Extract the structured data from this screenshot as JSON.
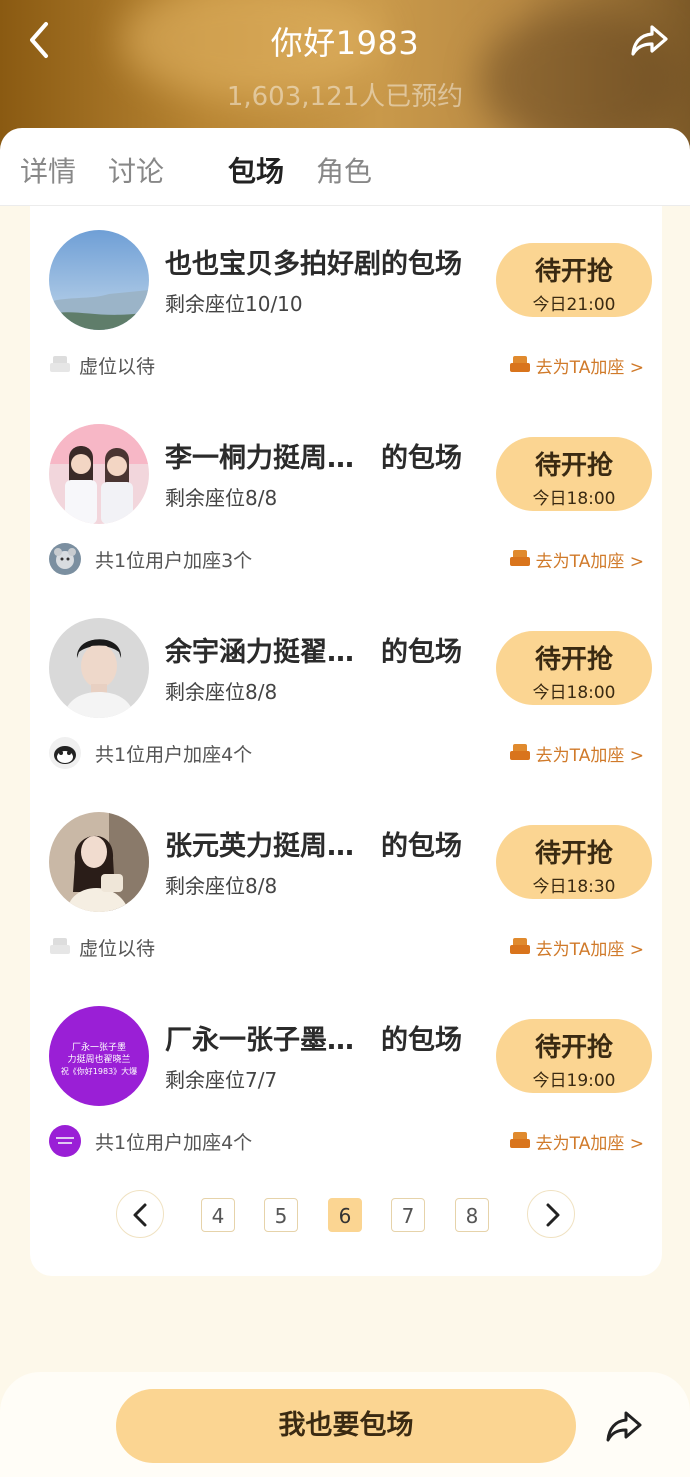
{
  "header": {
    "title": "你好1983",
    "subtitle": "1,603,121人已预约"
  },
  "tabs": [
    {
      "label": "详情"
    },
    {
      "label": "讨论"
    },
    {
      "label": "包场"
    },
    {
      "label": "角色"
    }
  ],
  "active_tab": "包场",
  "items": [
    {
      "title": "也也宝贝多拍好剧的包场",
      "seats": "剩余座位10/10",
      "btn_main": "待开抢",
      "btn_time": "今日21:00",
      "footer_left": "虚位以待",
      "footer_right": "去为TA加座 >",
      "avatar_icon": "landscape-avatar-icon"
    },
    {
      "title": "李一桐力挺周…　的包场",
      "seats": "剩余座位8/8",
      "btn_main": "待开抢",
      "btn_time": "今日18:00",
      "footer_left": "共1位用户加座3个",
      "footer_right": "去为TA加座 >",
      "avatar_icon": "two-girls-avatar-icon"
    },
    {
      "title": "余宇涵力挺翟…　的包场",
      "seats": "剩余座位8/8",
      "btn_main": "待开抢",
      "btn_time": "今日18:00",
      "footer_left": "共1位用户加座4个",
      "footer_right": "去为TA加座 >",
      "avatar_icon": "man-portrait-avatar-icon"
    },
    {
      "title": "张元英力挺周…　的包场",
      "seats": "剩余座位8/8",
      "btn_main": "待开抢",
      "btn_time": "今日18:30",
      "footer_left": "虚位以待",
      "footer_right": "去为TA加座 >",
      "avatar_icon": "girl-portrait-avatar-icon"
    },
    {
      "title": "厂永一张子墨…　的包场",
      "seats": "剩余座位7/7",
      "btn_main": "待开抢",
      "btn_time": "今日19:00",
      "footer_left": "共1位用户加座4个",
      "footer_right": "去为TA加座 >",
      "avatar_icon": "purple-text-avatar-icon",
      "avatar_text": [
        "厂永一张子墨",
        "力挺周也翟晓兰",
        "祝《你好1983》大爆"
      ]
    }
  ],
  "pagination": {
    "pages": [
      "4",
      "5",
      "6",
      "7",
      "8"
    ],
    "current": "6"
  },
  "bottom": {
    "cta_label": "我也要包场"
  },
  "colors": {
    "accent": "#fbd592",
    "link": "#d07a2a",
    "background": "#fdf8ea"
  }
}
